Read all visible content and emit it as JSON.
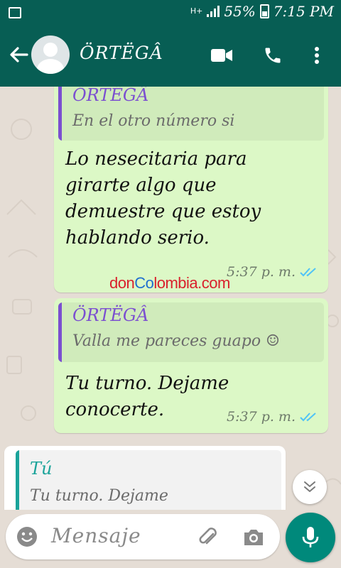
{
  "status_bar": {
    "network": "H+",
    "battery": "55%",
    "time": "7:15 PM"
  },
  "header": {
    "contact_name": "ÖRTËGÂ"
  },
  "messages": [
    {
      "quoted_name": "ÖRTËGÂ",
      "quoted_text": "En el otro número si",
      "text_lines": [
        "Lo nesecitaria para",
        "girarte algo que",
        "demuestre que estoy",
        "hablando serio."
      ],
      "time": "5:37 p. m."
    },
    {
      "quoted_name": "ÖRTËGÂ",
      "quoted_text": "Valla me pareces guapo ☺",
      "text_lines": [
        "Tu turno. Dejame",
        "conocerte."
      ],
      "time": "5:37 p. m."
    },
    {
      "quoted_name": "Tú",
      "quoted_text": "Tu turno. Dejame"
    }
  ],
  "watermark": {
    "don": "don",
    "co": "Co",
    "lombia": "lombia",
    "com": ".com"
  },
  "composer": {
    "placeholder": "Mensaje"
  },
  "colors": {
    "header": "#075e54",
    "outgoing_bubble": "#dcf8c6",
    "incoming_bubble": "#ffffff",
    "quote_author_bar": "#7b4fd0",
    "self_quote_bar": "#1aa39a",
    "read_ticks": "#4fc3f7",
    "mic_button": "#00897b"
  }
}
